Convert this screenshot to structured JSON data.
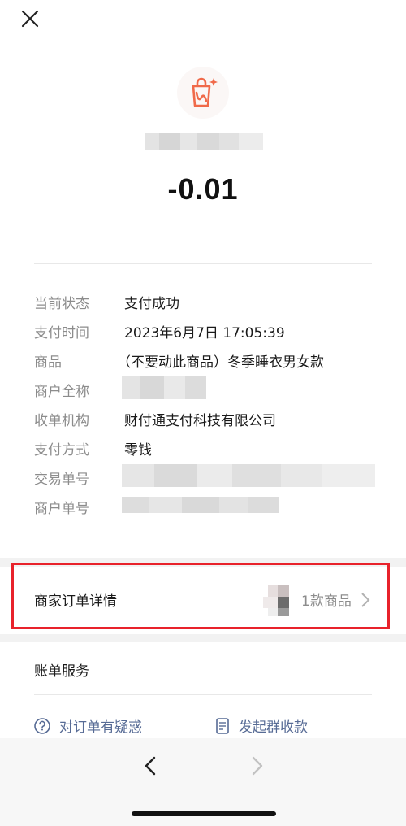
{
  "amount": "-0.01",
  "details": [
    {
      "label": "当前状态",
      "value": "支付成功"
    },
    {
      "label": "支付时间",
      "value": "2023年6月7日 17:05:39"
    },
    {
      "label": "商品",
      "value": "（不要动此商品）冬季睡衣男女款"
    },
    {
      "label": "商户全称",
      "value": ""
    },
    {
      "label": "收单机构",
      "value": "财付通支付科技有限公司"
    },
    {
      "label": "支付方式",
      "value": "零钱"
    },
    {
      "label": "交易单号",
      "value": ""
    },
    {
      "label": "商户单号",
      "value": ""
    }
  ],
  "merchant_order": {
    "label": "商家订单详情",
    "count_text": "1款商品"
  },
  "bill_service": {
    "title": "账单服务",
    "links": [
      {
        "label": "对订单有疑惑",
        "icon": "question-circle-icon"
      },
      {
        "label": "发起群收款",
        "icon": "receipt-icon"
      }
    ]
  },
  "colors": {
    "accent_icon": "#f06a4a",
    "link": "#576b95",
    "highlight_box": "#e8222b"
  }
}
